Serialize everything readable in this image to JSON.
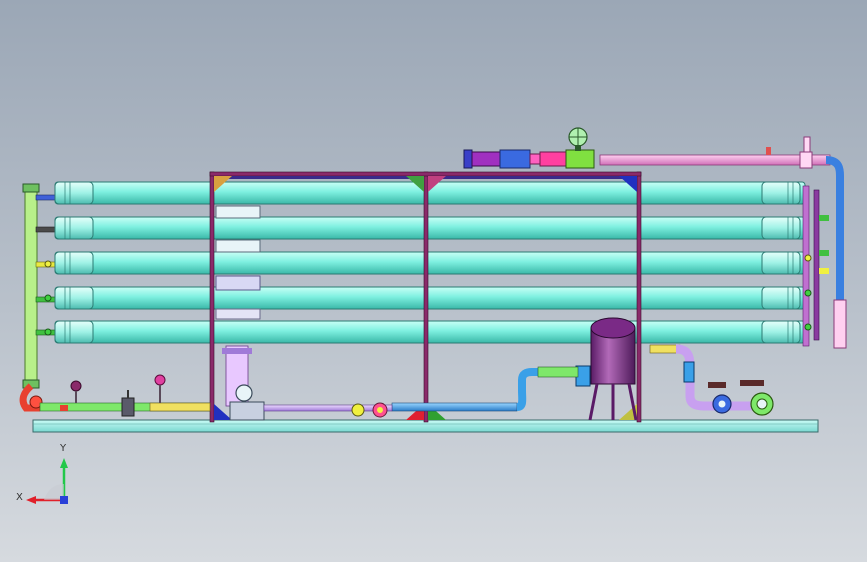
{
  "view": {
    "background_top": "#9ba7b6",
    "background_bottom": "#d6dadf"
  },
  "triad": {
    "x_label": "X",
    "y_label": "Y",
    "x_color": "#e0202a",
    "y_color": "#22c84a",
    "z_color": "#2a40d8"
  },
  "colors": {
    "membrane_tube": "#7ef0e0",
    "frame": "#8a2a6a",
    "frame_inner": "#3a2a8a",
    "base_skid": "#9ee8e4",
    "tank": "#8a3a90",
    "pipe_pink": "#f09ad8",
    "pipe_blue": "#3aa0e8",
    "pipe_green": "#7ee86a",
    "pipe_purple": "#c8a0f0"
  },
  "assembly": {
    "membrane_vessel_count": 5,
    "feed_tank_count": 1
  }
}
